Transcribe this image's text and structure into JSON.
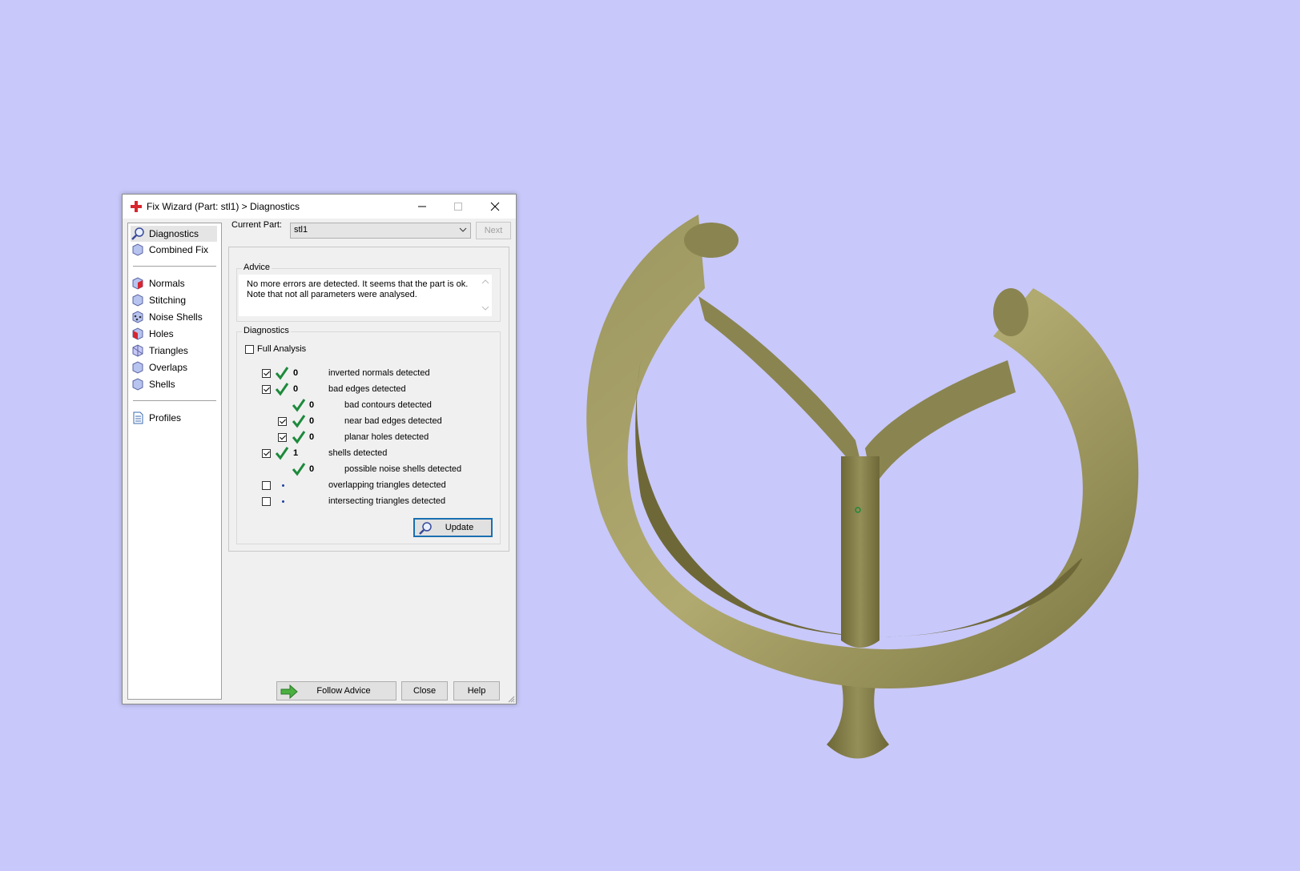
{
  "window": {
    "title": "Fix Wizard (Part: stl1) > Diagnostics"
  },
  "sidebar": {
    "items": [
      {
        "label": "Diagnostics",
        "icon": "magnifier-icon"
      },
      {
        "label": "Combined Fix",
        "icon": "cube-icon"
      },
      {
        "label": "Normals",
        "icon": "cube-red-face-icon"
      },
      {
        "label": "Stitching",
        "icon": "cube-icon"
      },
      {
        "label": "Noise Shells",
        "icon": "cube-dots-icon"
      },
      {
        "label": "Holes",
        "icon": "cube-red-face-icon"
      },
      {
        "label": "Triangles",
        "icon": "cube-triangles-icon"
      },
      {
        "label": "Overlaps",
        "icon": "cube-icon"
      },
      {
        "label": "Shells",
        "icon": "cube-icon"
      },
      {
        "label": "Profiles",
        "icon": "document-icon"
      }
    ]
  },
  "current_part": {
    "label": "Current Part:",
    "value": "stl1",
    "next_label": "Next"
  },
  "advice": {
    "title": "Advice",
    "text_line1": "No more errors are detected. It seems that the part is ok.",
    "text_line2": "Note that not all parameters were analysed."
  },
  "diagnostics": {
    "title": "Diagnostics",
    "full_analysis_label": "Full Analysis",
    "rows": [
      {
        "count": "0",
        "label": "inverted normals detected"
      },
      {
        "count": "0",
        "label": "bad edges detected"
      },
      {
        "count": "0",
        "label": "bad contours detected"
      },
      {
        "count": "0",
        "label": "near bad edges detected"
      },
      {
        "count": "0",
        "label": "planar holes detected"
      },
      {
        "count": "1",
        "label": "shells detected"
      },
      {
        "count": "0",
        "label": "possible noise shells detected"
      },
      {
        "count": "",
        "label": "overlapping triangles detected"
      },
      {
        "count": "",
        "label": "intersecting triangles detected"
      }
    ],
    "update_label": "Update"
  },
  "footer": {
    "follow_advice_label": "Follow Advice",
    "close_label": "Close",
    "help_label": "Help"
  },
  "colors": {
    "background": "#c8c8fa",
    "model": "#8c8650",
    "check": "#1e8a3c"
  }
}
